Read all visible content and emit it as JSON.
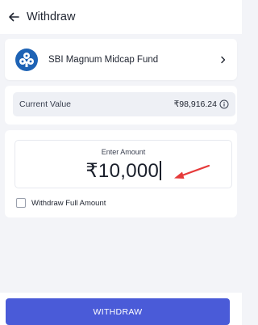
{
  "header": {
    "title": "Withdraw",
    "back_icon": "arrow-left-icon"
  },
  "fund": {
    "name": "SBI Magnum Midcap Fund",
    "logo_icon": "sbi-mutual-fund-logo",
    "chevron_icon": "chevron-right-icon"
  },
  "current_value": {
    "label": "Current Value",
    "amount": "₹98,916.24",
    "info_icon": "info-icon"
  },
  "amount_entry": {
    "label": "Enter Amount",
    "value": "₹10,000",
    "annotation_icon": "red-arrow-annotation",
    "annotation_color": "#e63a3a"
  },
  "full_amount": {
    "label": "Withdraw Full Amount",
    "checked": false
  },
  "action": {
    "button_label": "WITHDRAW"
  },
  "colors": {
    "accent": "#4a5bd8",
    "logo_blue": "#1e63b5",
    "background": "#f3f4f8"
  }
}
